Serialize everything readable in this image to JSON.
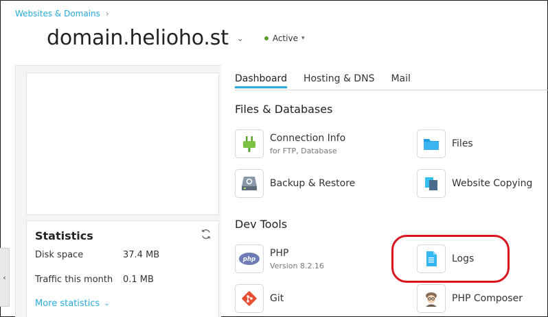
{
  "breadcrumb": {
    "label": "Websites & Domains",
    "separator": "›"
  },
  "header": {
    "title": "domain.helioho.st",
    "title_chevron": "⌄",
    "status": {
      "label": "Active",
      "color": "#5aa02c"
    }
  },
  "statistics": {
    "title": "Statistics",
    "rows": [
      {
        "label": "Disk space",
        "value": "37.4 MB"
      },
      {
        "label": "Traffic this month",
        "value": "0.1 MB"
      }
    ],
    "more_link": "More statistics"
  },
  "tabs": [
    {
      "label": "Dashboard",
      "active": true
    },
    {
      "label": "Hosting & DNS",
      "active": false
    },
    {
      "label": "Mail",
      "active": false
    }
  ],
  "sections": {
    "files_databases": {
      "title": "Files & Databases",
      "items": [
        {
          "name": "Connection Info",
          "sub": "for FTP, Database",
          "icon": "plug-icon"
        },
        {
          "name": "Files",
          "sub": "",
          "icon": "folder-icon"
        },
        {
          "name": "Backup & Restore",
          "sub": "",
          "icon": "backup-drive-icon"
        },
        {
          "name": "Website Copying",
          "sub": "",
          "icon": "copy-pages-icon"
        }
      ]
    },
    "dev_tools": {
      "title": "Dev Tools",
      "items": [
        {
          "name": "PHP",
          "sub": "Version 8.2.16",
          "icon": "php-icon"
        },
        {
          "name": "Logs",
          "sub": "",
          "icon": "log-document-icon"
        },
        {
          "name": "Git",
          "sub": "",
          "icon": "git-icon"
        },
        {
          "name": "PHP Composer",
          "sub": "",
          "icon": "composer-icon"
        }
      ]
    }
  },
  "colors": {
    "accent": "#28aade",
    "annotation": "#d9141d",
    "active_status": "#5aa02c"
  }
}
